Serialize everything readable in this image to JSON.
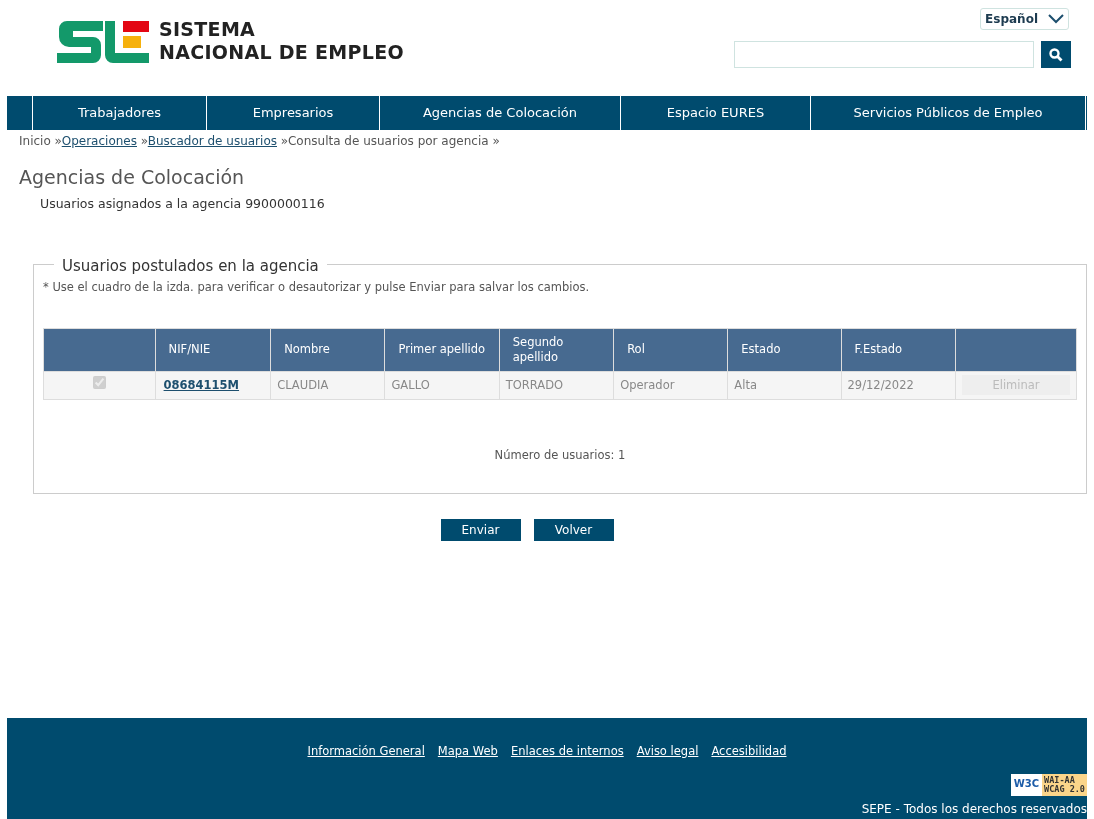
{
  "logo": {
    "line_1": "SISTEMA",
    "line_2": "NACIONAL DE EMPLEO"
  },
  "language_select": {
    "value": "Español"
  },
  "nav": [
    {
      "label": "Trabajadores"
    },
    {
      "label": "Empresarios"
    },
    {
      "label": "Agencias de Colocación"
    },
    {
      "label": "Espacio EURES"
    },
    {
      "label": "Servicios Públicos de Empleo"
    }
  ],
  "breadcrumb": [
    {
      "label": "Inicio",
      "kind": "text",
      "separator": "»"
    },
    {
      "label": "Operaciones",
      "kind": "link",
      "separator": "»"
    },
    {
      "label": "Buscador de usuarios",
      "kind": "link",
      "separator": "»"
    },
    {
      "label": "Consulta de usuarios por agencia",
      "kind": "text",
      "separator": "»"
    }
  ],
  "page_title": "Agencias de Colocación",
  "subtitle": "Usuarios asignados a la agencia 9900000116",
  "fieldset": {
    "legend": "Usuarios postulados en la agencia",
    "note": "* Use el cuadro de la izda. para verificar o desautorizar y pulse Enviar para salvar los cambios.",
    "table": {
      "columns": [
        "NIF/NIE",
        "Nombre",
        "Primer apellido",
        "Segundo apellido",
        "Rol",
        "Estado",
        "F.Estado"
      ],
      "rows": [
        {
          "checked": true,
          "checkbox_disabled": true,
          "nif": "08684115M",
          "nombre": "CLAUDIA",
          "primer_apellido": "GALLO",
          "segundo_apellido": "TORRADO",
          "rol": "Operador",
          "estado": "Alta",
          "f_estado": "29/12/2022",
          "action": "Eliminar",
          "action_disabled": true
        }
      ]
    },
    "count": "Número de usuarios: 1"
  },
  "buttons": [
    {
      "label": "Enviar"
    },
    {
      "label": "Volver"
    }
  ],
  "footer": {
    "links": [
      "Información General",
      "Mapa Web",
      "Enlaces de internos",
      "Aviso legal",
      "Accesibilidad"
    ],
    "badge": {
      "left": "W3C",
      "top": "WAI-AA",
      "bottom": "WCAG 2.0"
    },
    "copyright": "SEPE - Todos los derechos reservados"
  }
}
